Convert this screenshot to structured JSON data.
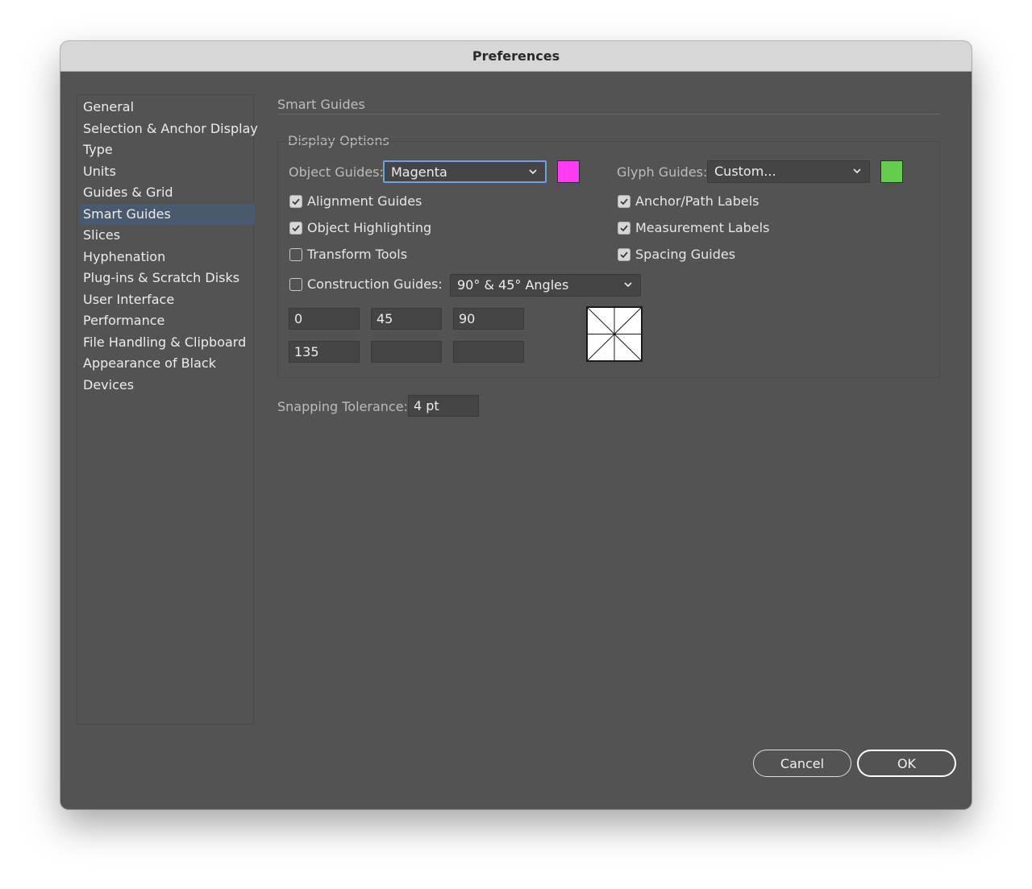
{
  "window": {
    "title": "Preferences"
  },
  "sidebar": {
    "items": [
      {
        "label": "General",
        "active": false
      },
      {
        "label": "Selection & Anchor Display",
        "active": false
      },
      {
        "label": "Type",
        "active": false
      },
      {
        "label": "Units",
        "active": false
      },
      {
        "label": "Guides & Grid",
        "active": false
      },
      {
        "label": "Smart Guides",
        "active": true
      },
      {
        "label": "Slices",
        "active": false
      },
      {
        "label": "Hyphenation",
        "active": false
      },
      {
        "label": "Plug-ins & Scratch Disks",
        "active": false
      },
      {
        "label": "User Interface",
        "active": false
      },
      {
        "label": "Performance",
        "active": false
      },
      {
        "label": "File Handling & Clipboard",
        "active": false
      },
      {
        "label": "Appearance of Black",
        "active": false
      },
      {
        "label": "Devices",
        "active": false
      }
    ]
  },
  "panel": {
    "title": "Smart Guides",
    "display_options": {
      "heading": "Display Options",
      "object_guides": {
        "label": "Object Guides:",
        "value": "Magenta",
        "swatch_color": "#ff3cf2"
      },
      "glyph_guides": {
        "label": "Glyph Guides:",
        "value": "Custom...",
        "swatch_color": "#66cc4f"
      },
      "checkboxes_left": [
        {
          "label": "Alignment Guides",
          "checked": true
        },
        {
          "label": "Object Highlighting",
          "checked": true
        },
        {
          "label": "Transform Tools",
          "checked": false
        }
      ],
      "checkboxes_right": [
        {
          "label": "Anchor/Path Labels",
          "checked": true
        },
        {
          "label": "Measurement Labels",
          "checked": true
        },
        {
          "label": "Spacing Guides",
          "checked": true
        }
      ],
      "construction_guides": {
        "label": "Construction Guides:",
        "checked": false,
        "value": "90° & 45° Angles",
        "angles": [
          "0",
          "45",
          "90",
          "135",
          "",
          ""
        ]
      }
    },
    "snapping_tolerance": {
      "label": "Snapping Tolerance:",
      "value": "4 pt"
    }
  },
  "buttons": {
    "cancel": "Cancel",
    "ok": "OK"
  },
  "colors": {
    "window_bg": "#535353",
    "selection": "#4a5a6e",
    "focus_ring": "#6aa2e8"
  }
}
